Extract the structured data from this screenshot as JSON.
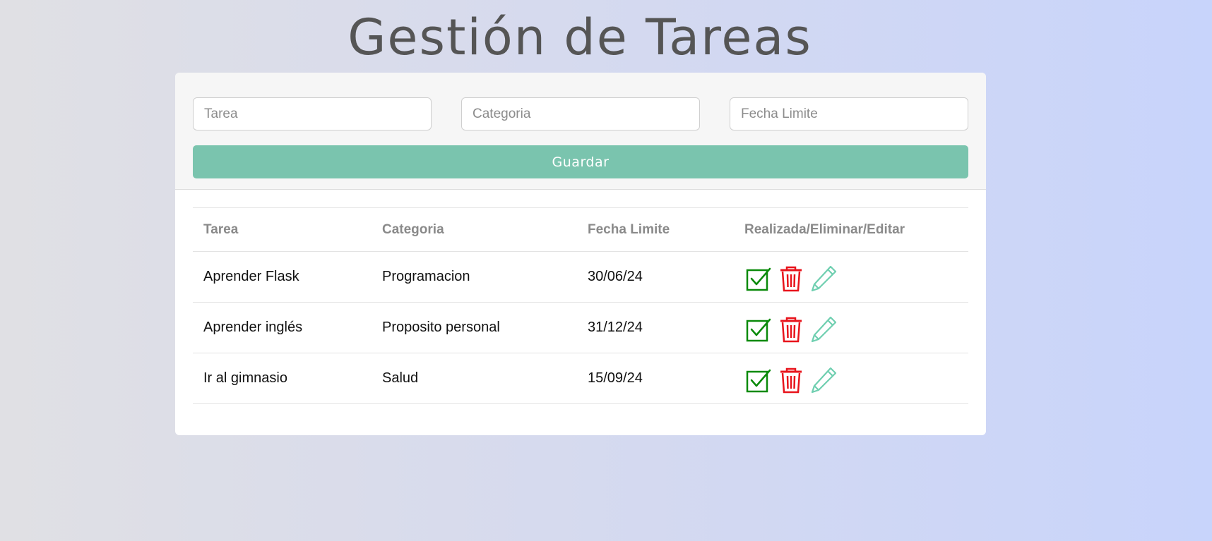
{
  "page": {
    "title": "Gestión de Tareas"
  },
  "form": {
    "task_placeholder": "Tarea",
    "category_placeholder": "Categoria",
    "deadline_placeholder": "Fecha Limite",
    "save_label": "Guardar"
  },
  "table": {
    "headers": [
      "Tarea",
      "Categoria",
      "Fecha Limite",
      "Realizada/Eliminar/Editar"
    ],
    "rows": [
      {
        "task": "Aprender Flask",
        "category": "Programacion",
        "deadline": "30/06/24"
      },
      {
        "task": "Aprender inglés",
        "category": "Proposito personal",
        "deadline": "31/12/24"
      },
      {
        "task": "Ir al gimnasio",
        "category": "Salud",
        "deadline": "15/09/24"
      }
    ]
  },
  "icons": {
    "done": "check-square-icon",
    "delete": "trash-icon",
    "edit": "pencil-icon"
  },
  "colors": {
    "accent": "#7ac4ae",
    "done": "#0a8a0a",
    "delete": "#e8141c",
    "edit": "#6fcfb0",
    "title": "#555555"
  }
}
